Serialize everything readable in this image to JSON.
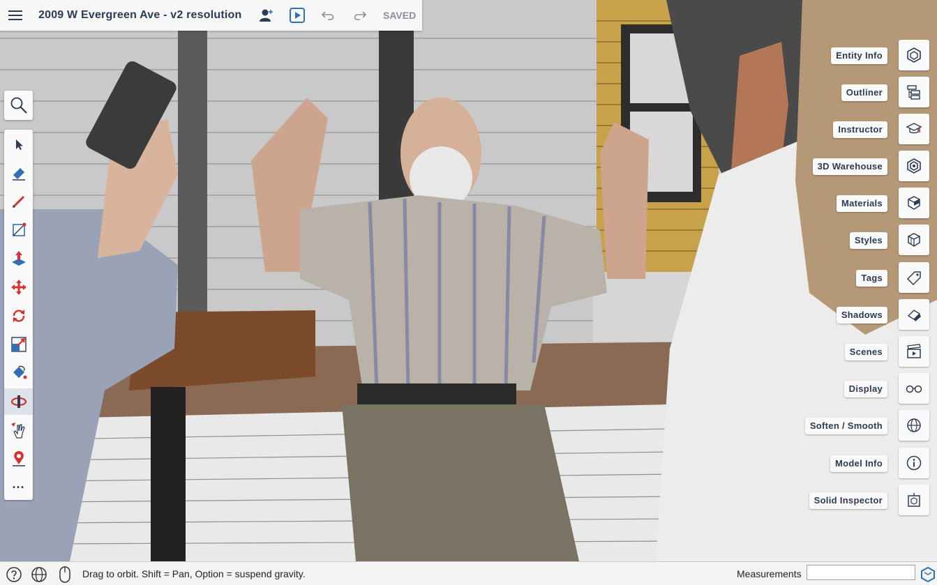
{
  "topbar": {
    "menu_icon": "hamburger-icon",
    "title": "2009 W Evergreen Ave - v2 resolution",
    "saved_label": "SAVED"
  },
  "panels": [
    {
      "label": "Entity Info",
      "icon": "entity-info-icon"
    },
    {
      "label": "Outliner",
      "icon": "outliner-icon"
    },
    {
      "label": "Instructor",
      "icon": "instructor-icon"
    },
    {
      "label": "3D Warehouse",
      "icon": "warehouse-icon"
    },
    {
      "label": "Materials",
      "icon": "materials-icon"
    },
    {
      "label": "Styles",
      "icon": "styles-icon"
    },
    {
      "label": "Tags",
      "icon": "tags-icon"
    },
    {
      "label": "Shadows",
      "icon": "shadows-icon"
    },
    {
      "label": "Scenes",
      "icon": "scenes-icon"
    },
    {
      "label": "Display",
      "icon": "display-icon"
    },
    {
      "label": "Soften / Smooth",
      "icon": "soften-smooth-icon"
    },
    {
      "label": "Model Info",
      "icon": "model-info-icon"
    },
    {
      "label": "Solid Inspector",
      "icon": "solid-inspector-icon"
    }
  ],
  "tools": [
    "select",
    "eraser",
    "pencil",
    "rectangle",
    "push-pull",
    "move",
    "rotate",
    "scale",
    "paint-bucket",
    "walk",
    "orbit-hand",
    "position-camera",
    "more"
  ],
  "tools_more": "···",
  "status": {
    "hint": "Drag to orbit. Shift = Pan, Option = suspend gravity.",
    "measurements_label": "Measurements",
    "measurements_value": ""
  },
  "colors": {
    "accent": "#2f6fb2",
    "tool_red": "#d8302c",
    "title": "#2b3a55"
  }
}
